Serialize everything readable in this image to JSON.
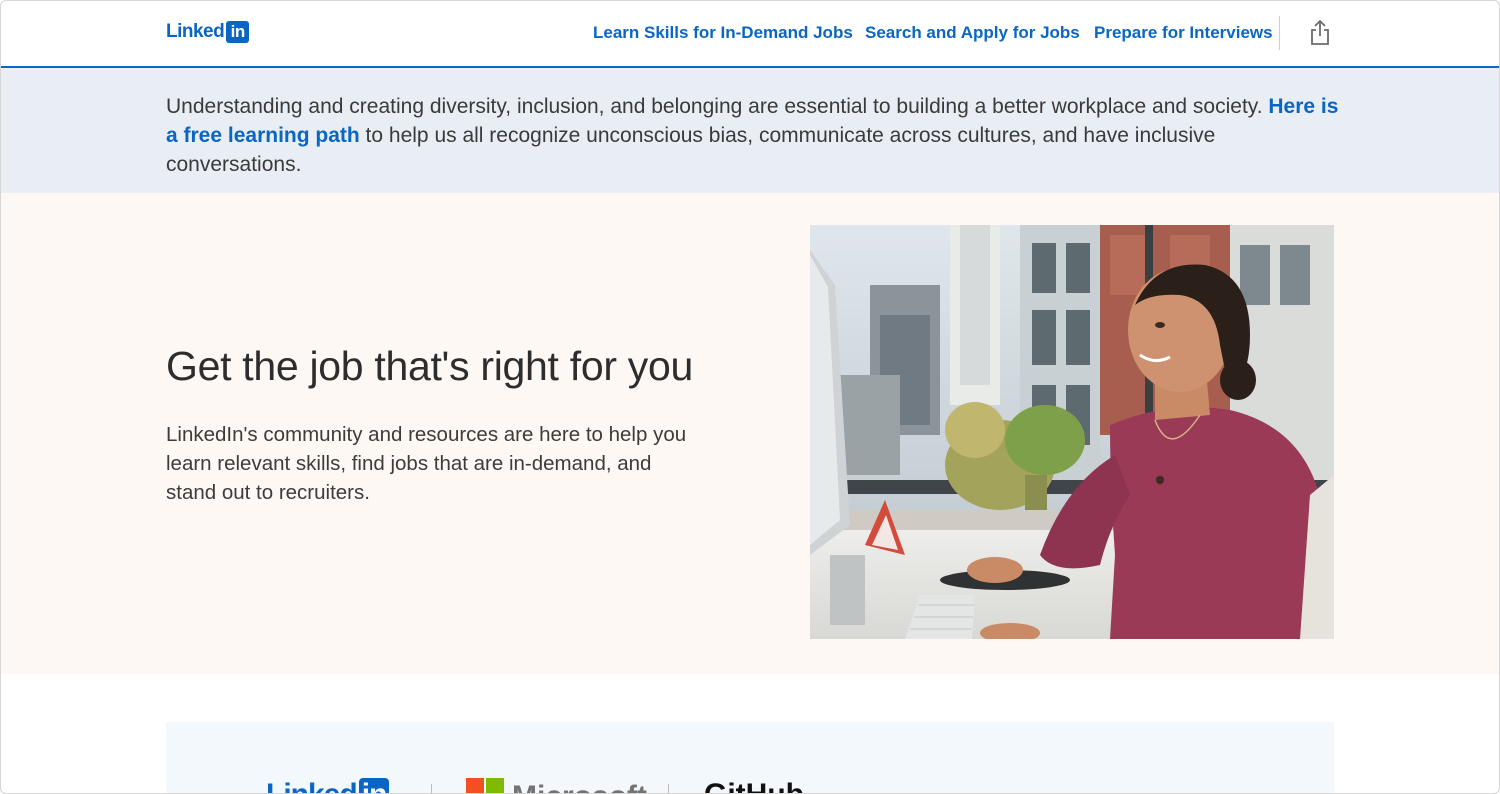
{
  "header": {
    "logo_text": "Linked",
    "logo_box": "in",
    "nav": [
      {
        "label": "Learn Skills for In-Demand Jobs"
      },
      {
        "label": "Search and Apply for Jobs"
      },
      {
        "label": "Prepare for Interviews"
      }
    ],
    "share_icon": "share-icon"
  },
  "banner": {
    "text_before": "Understanding and creating diversity, inclusion, and belonging are essential to building a better workplace and society. ",
    "link_text": "Here is a free learning path",
    "text_after": " to help us all recognize unconscious bias, communicate across cultures, and have inclusive conversations."
  },
  "hero": {
    "title": "Get the job that's right for you",
    "body": "LinkedIn's community and resources are here to help you learn relevant skills, find jobs that are in-demand, and stand out to recruiters."
  },
  "partners": {
    "linkedin": {
      "text": "Linked",
      "box": "in"
    },
    "microsoft": {
      "text": "Microsoft"
    },
    "github": {
      "text": "GitHub"
    }
  },
  "colors": {
    "accent": "#0a66c2",
    "banner_bg": "#e9eef5",
    "hero_bg": "#fdf8f3"
  }
}
